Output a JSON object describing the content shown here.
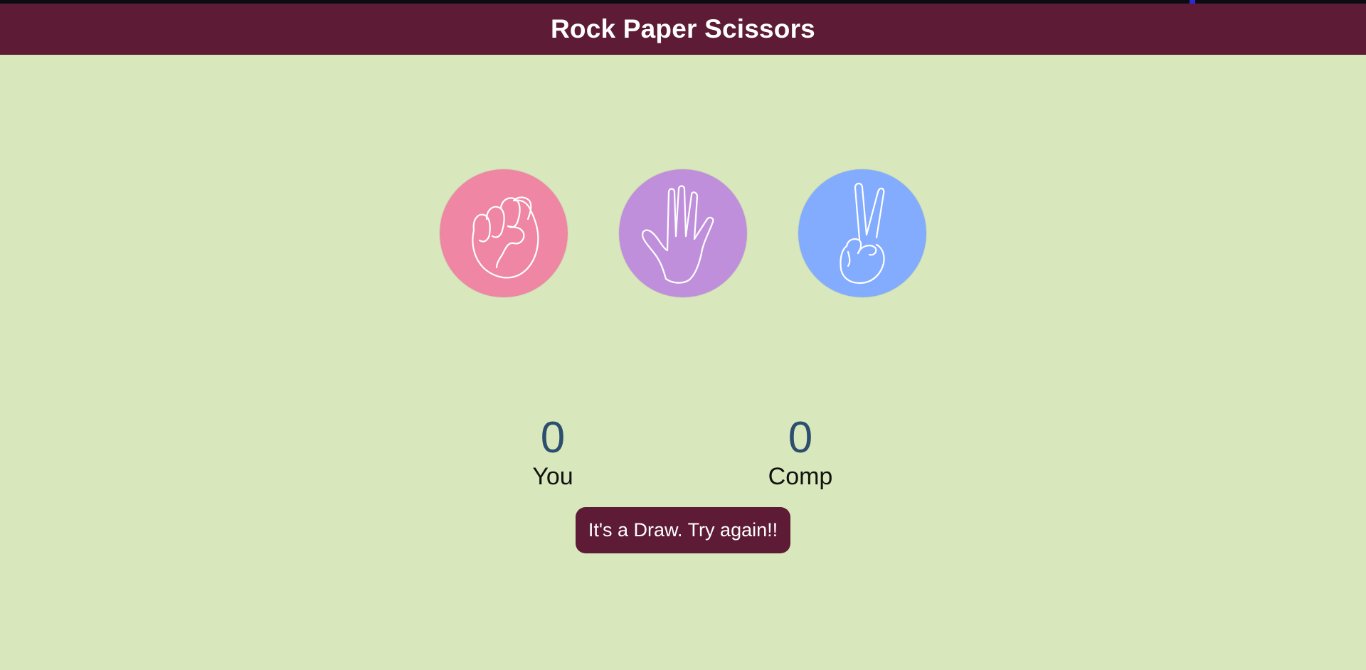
{
  "app": {
    "title": "Rock Paper Scissors"
  },
  "choices": [
    {
      "id": "rock",
      "icon": "fist-icon",
      "color": "#ef86a4"
    },
    {
      "id": "paper",
      "icon": "open-hand-icon",
      "color": "#c08fdc"
    },
    {
      "id": "scissors",
      "icon": "peace-hand-icon",
      "color": "#84acfe"
    }
  ],
  "scores": {
    "user": {
      "value": "0",
      "label": "You"
    },
    "comp": {
      "value": "0",
      "label": "Comp"
    }
  },
  "message": {
    "text": "It's a Draw. Try again!!"
  },
  "colors": {
    "background": "#d8e8bc",
    "header": "#5e1b35",
    "score_number": "#2d4e6e",
    "message_bg": "#5e1b35"
  }
}
